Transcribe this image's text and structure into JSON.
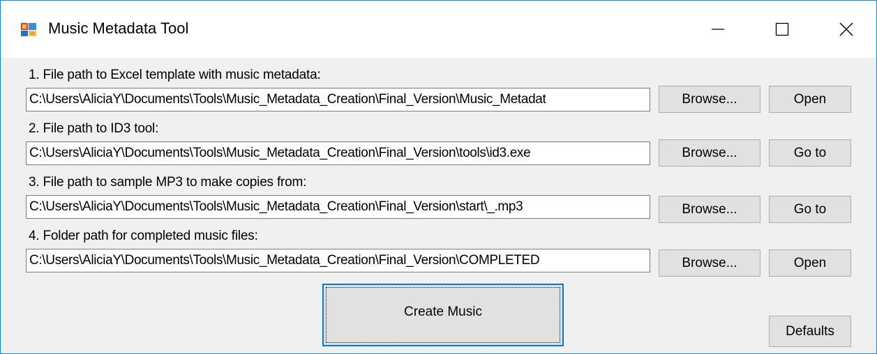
{
  "window": {
    "title": "Music Metadata Tool",
    "accent_color": "#1883d7",
    "controls": {
      "minimize_icon": "minimize-icon",
      "maximize_icon": "maximize-icon",
      "close_icon": "close-icon"
    }
  },
  "rows": [
    {
      "label": "1. File path to Excel template with music metadata:",
      "value": "C:\\Users\\AliciaY\\Documents\\Tools\\Music_Metadata_Creation\\Final_Version\\Music_Metadat",
      "browse_label": "Browse...",
      "action_label": "Open"
    },
    {
      "label": "2. File path to ID3 tool:",
      "value": "C:\\Users\\AliciaY\\Documents\\Tools\\Music_Metadata_Creation\\Final_Version\\tools\\id3.exe",
      "browse_label": "Browse...",
      "action_label": "Go to"
    },
    {
      "label": "3. File path to sample MP3 to make copies from:",
      "value": "C:\\Users\\AliciaY\\Documents\\Tools\\Music_Metadata_Creation\\Final_Version\\start\\_.mp3",
      "browse_label": "Browse...",
      "action_label": "Go to"
    },
    {
      "label": "4. Folder path for completed music files:",
      "value": "C:\\Users\\AliciaY\\Documents\\Tools\\Music_Metadata_Creation\\Final_Version\\COMPLETED",
      "browse_label": "Browse...",
      "action_label": "Open"
    }
  ],
  "buttons": {
    "create_label": "Create Music",
    "defaults_label": "Defaults"
  }
}
